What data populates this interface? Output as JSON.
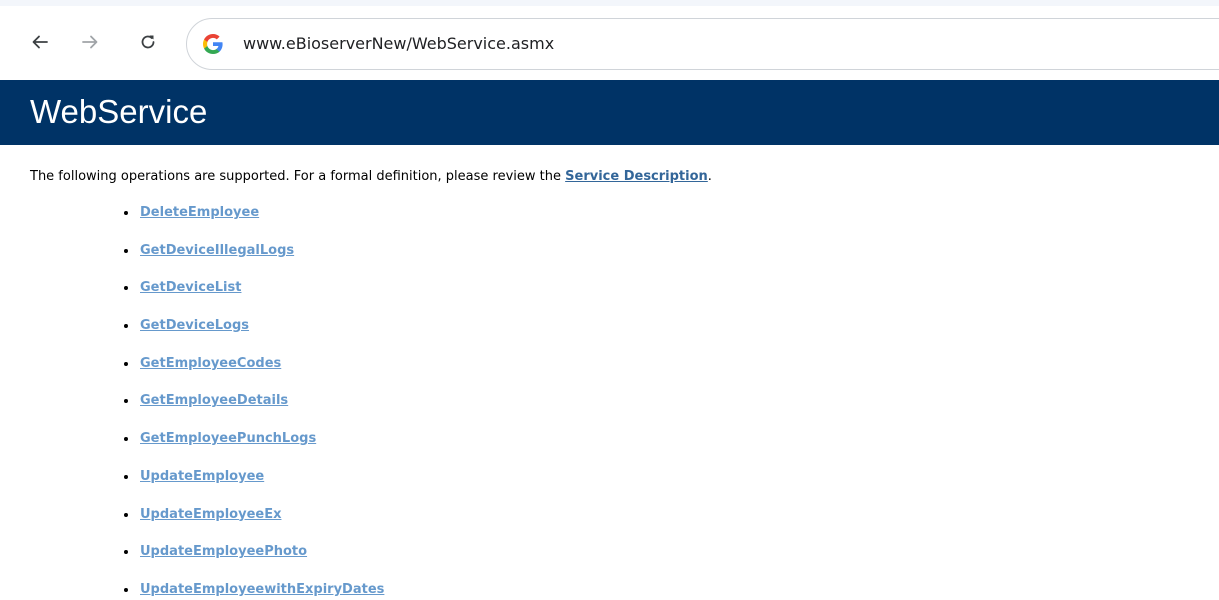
{
  "browser": {
    "url": "www.eBioserverNew/WebService.asmx"
  },
  "page": {
    "title": "WebService",
    "intro_text": "The following operations are supported. For a formal definition, please review the ",
    "intro_link": "Service Description",
    "intro_end": "."
  },
  "operations": [
    "DeleteEmployee",
    "GetDeviceIllegalLogs",
    "GetDeviceList",
    "GetDeviceLogs",
    "GetEmployeeCodes",
    "GetEmployeeDetails",
    "GetEmployeePunchLogs",
    "UpdateEmployee",
    "UpdateEmployeeEx",
    "UpdateEmployeePhoto",
    "UpdateEmployeewithExpiryDates"
  ],
  "colors": {
    "header_background": "#003366",
    "link": "#6699cc",
    "description_link": "#336699"
  },
  "icons": {
    "back": "arrow-left",
    "forward": "arrow-right",
    "reload": "reload",
    "site": "google-g-logo"
  }
}
